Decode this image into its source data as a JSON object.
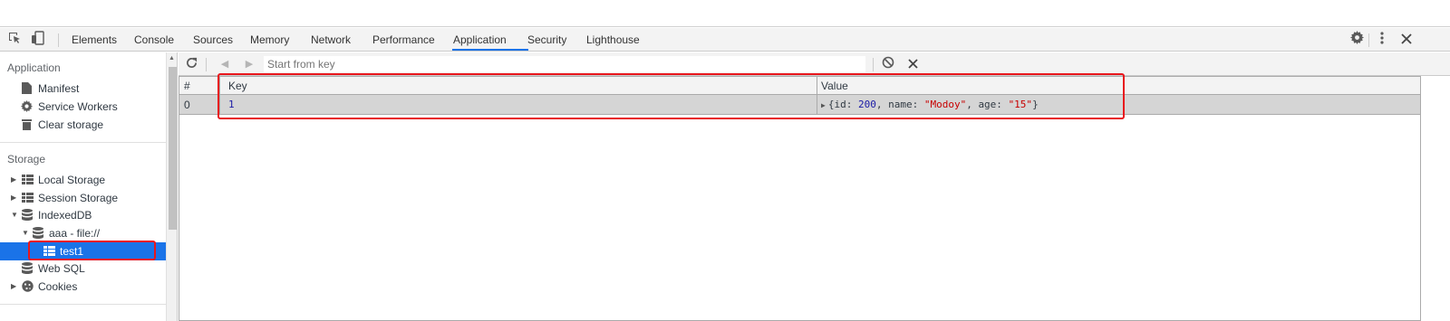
{
  "devtools": {
    "tabs": [
      "Elements",
      "Console",
      "Sources",
      "Memory",
      "Network",
      "Performance",
      "Application",
      "Security",
      "Lighthouse"
    ],
    "active_tab": "Application"
  },
  "sidebar": {
    "application_header": "Application",
    "application_items": [
      "Manifest",
      "Service Workers",
      "Clear storage"
    ],
    "storage_header": "Storage",
    "storage_items": {
      "local_storage": "Local Storage",
      "session_storage": "Session Storage",
      "indexeddb": "IndexedDB",
      "db": "aaa - file://",
      "store": "test1",
      "web_sql": "Web SQL",
      "cookies": "Cookies"
    }
  },
  "toolbar": {
    "search_placeholder": "Start from key"
  },
  "table": {
    "headers": [
      "#",
      "Key",
      "Value"
    ],
    "rows": [
      {
        "index": "0",
        "key": "1",
        "value": {
          "open": "{",
          "id_key": "id: ",
          "id_val": "200",
          "sep1": ", ",
          "name_key": "name: ",
          "name_val": "\"Modoy\"",
          "sep2": ", ",
          "age_key": "age: ",
          "age_val": "\"15\"",
          "close": "}"
        }
      }
    ]
  },
  "colors": {
    "accent": "#1a73e8",
    "highlight": "#e8161c"
  }
}
